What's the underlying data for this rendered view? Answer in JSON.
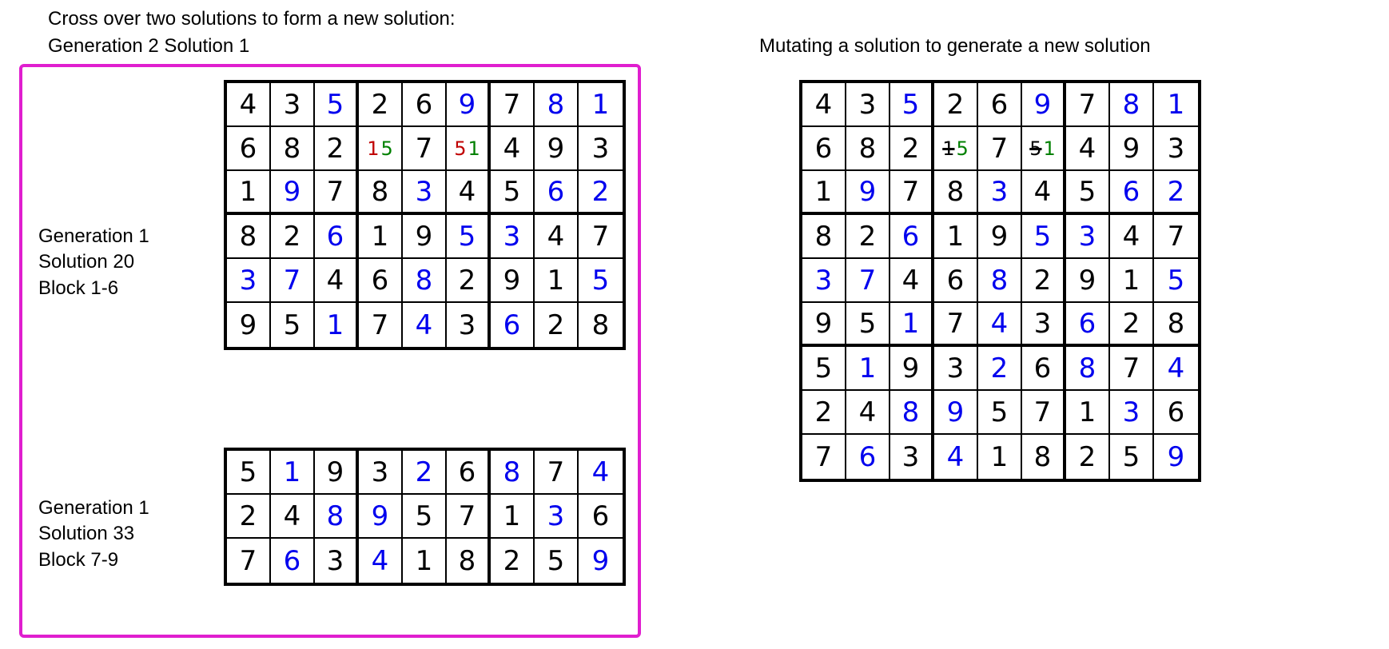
{
  "titles": {
    "crossover_line1": "Cross over two solutions to form a new solution:",
    "crossover_line2": "Generation 2 Solution 1",
    "mutation_title": "Mutating a solution to generate a new solution",
    "label_top": "Generation 1\nSolution 20\nBlock 1-6",
    "label_bottom": "Generation 1\nSolution 33\nBlock 7-9"
  },
  "colors": {
    "black": "#000000",
    "blue": "#0000ee",
    "red": "#c00000",
    "green": "#008000",
    "magenta": "#e01ecf"
  },
  "grid_top": {
    "rows": 6,
    "cells": [
      [
        {
          "v": "4",
          "c": "black"
        },
        {
          "v": "3",
          "c": "black"
        },
        {
          "v": "5",
          "c": "blue"
        },
        {
          "v": "2",
          "c": "black"
        },
        {
          "v": "6",
          "c": "black"
        },
        {
          "v": "9",
          "c": "blue"
        },
        {
          "v": "7",
          "c": "black"
        },
        {
          "v": "8",
          "c": "blue"
        },
        {
          "v": "1",
          "c": "blue"
        }
      ],
      [
        {
          "v": "6",
          "c": "black"
        },
        {
          "v": "8",
          "c": "black"
        },
        {
          "v": "2",
          "c": "black"
        },
        {
          "pair": [
            {
              "v": "1",
              "c": "red"
            },
            {
              "v": "5",
              "c": "green"
            }
          ]
        },
        {
          "v": "7",
          "c": "black"
        },
        {
          "pair": [
            {
              "v": "5",
              "c": "red"
            },
            {
              "v": "1",
              "c": "green"
            }
          ]
        },
        {
          "v": "4",
          "c": "black"
        },
        {
          "v": "9",
          "c": "black"
        },
        {
          "v": "3",
          "c": "black"
        }
      ],
      [
        {
          "v": "1",
          "c": "black"
        },
        {
          "v": "9",
          "c": "blue"
        },
        {
          "v": "7",
          "c": "black"
        },
        {
          "v": "8",
          "c": "black"
        },
        {
          "v": "3",
          "c": "blue"
        },
        {
          "v": "4",
          "c": "black"
        },
        {
          "v": "5",
          "c": "black"
        },
        {
          "v": "6",
          "c": "blue"
        },
        {
          "v": "2",
          "c": "blue"
        }
      ],
      [
        {
          "v": "8",
          "c": "black"
        },
        {
          "v": "2",
          "c": "black"
        },
        {
          "v": "6",
          "c": "blue"
        },
        {
          "v": "1",
          "c": "black"
        },
        {
          "v": "9",
          "c": "black"
        },
        {
          "v": "5",
          "c": "blue"
        },
        {
          "v": "3",
          "c": "blue"
        },
        {
          "v": "4",
          "c": "black"
        },
        {
          "v": "7",
          "c": "black"
        }
      ],
      [
        {
          "v": "3",
          "c": "blue"
        },
        {
          "v": "7",
          "c": "blue"
        },
        {
          "v": "4",
          "c": "black"
        },
        {
          "v": "6",
          "c": "black"
        },
        {
          "v": "8",
          "c": "blue"
        },
        {
          "v": "2",
          "c": "black"
        },
        {
          "v": "9",
          "c": "black"
        },
        {
          "v": "1",
          "c": "black"
        },
        {
          "v": "5",
          "c": "blue"
        }
      ],
      [
        {
          "v": "9",
          "c": "black"
        },
        {
          "v": "5",
          "c": "black"
        },
        {
          "v": "1",
          "c": "blue"
        },
        {
          "v": "7",
          "c": "black"
        },
        {
          "v": "4",
          "c": "blue"
        },
        {
          "v": "3",
          "c": "black"
        },
        {
          "v": "6",
          "c": "blue"
        },
        {
          "v": "2",
          "c": "black"
        },
        {
          "v": "8",
          "c": "black"
        }
      ]
    ]
  },
  "grid_bottom": {
    "rows": 3,
    "cells": [
      [
        {
          "v": "5",
          "c": "black"
        },
        {
          "v": "1",
          "c": "blue"
        },
        {
          "v": "9",
          "c": "black"
        },
        {
          "v": "3",
          "c": "black"
        },
        {
          "v": "2",
          "c": "blue"
        },
        {
          "v": "6",
          "c": "black"
        },
        {
          "v": "8",
          "c": "blue"
        },
        {
          "v": "7",
          "c": "black"
        },
        {
          "v": "4",
          "c": "blue"
        }
      ],
      [
        {
          "v": "2",
          "c": "black"
        },
        {
          "v": "4",
          "c": "black"
        },
        {
          "v": "8",
          "c": "blue"
        },
        {
          "v": "9",
          "c": "blue"
        },
        {
          "v": "5",
          "c": "black"
        },
        {
          "v": "7",
          "c": "black"
        },
        {
          "v": "1",
          "c": "black"
        },
        {
          "v": "3",
          "c": "blue"
        },
        {
          "v": "6",
          "c": "black"
        }
      ],
      [
        {
          "v": "7",
          "c": "black"
        },
        {
          "v": "6",
          "c": "blue"
        },
        {
          "v": "3",
          "c": "black"
        },
        {
          "v": "4",
          "c": "blue"
        },
        {
          "v": "1",
          "c": "black"
        },
        {
          "v": "8",
          "c": "black"
        },
        {
          "v": "2",
          "c": "black"
        },
        {
          "v": "5",
          "c": "black"
        },
        {
          "v": "9",
          "c": "blue"
        }
      ]
    ]
  },
  "grid_right": {
    "rows": 9,
    "cells": [
      [
        {
          "v": "4",
          "c": "black"
        },
        {
          "v": "3",
          "c": "black"
        },
        {
          "v": "5",
          "c": "blue"
        },
        {
          "v": "2",
          "c": "black"
        },
        {
          "v": "6",
          "c": "black"
        },
        {
          "v": "9",
          "c": "blue"
        },
        {
          "v": "7",
          "c": "black"
        },
        {
          "v": "8",
          "c": "blue"
        },
        {
          "v": "1",
          "c": "blue"
        }
      ],
      [
        {
          "v": "6",
          "c": "black"
        },
        {
          "v": "8",
          "c": "black"
        },
        {
          "v": "2",
          "c": "black"
        },
        {
          "pair": [
            {
              "v": "1",
              "c": "black",
              "strike": true
            },
            {
              "v": "5",
              "c": "green"
            }
          ]
        },
        {
          "v": "7",
          "c": "black"
        },
        {
          "pair": [
            {
              "v": "5",
              "c": "black",
              "strike": true
            },
            {
              "v": "1",
              "c": "green"
            }
          ]
        },
        {
          "v": "4",
          "c": "black"
        },
        {
          "v": "9",
          "c": "black"
        },
        {
          "v": "3",
          "c": "black"
        }
      ],
      [
        {
          "v": "1",
          "c": "black"
        },
        {
          "v": "9",
          "c": "blue"
        },
        {
          "v": "7",
          "c": "black"
        },
        {
          "v": "8",
          "c": "black"
        },
        {
          "v": "3",
          "c": "blue"
        },
        {
          "v": "4",
          "c": "black"
        },
        {
          "v": "5",
          "c": "black"
        },
        {
          "v": "6",
          "c": "blue"
        },
        {
          "v": "2",
          "c": "blue"
        }
      ],
      [
        {
          "v": "8",
          "c": "black"
        },
        {
          "v": "2",
          "c": "black"
        },
        {
          "v": "6",
          "c": "blue"
        },
        {
          "v": "1",
          "c": "black"
        },
        {
          "v": "9",
          "c": "black"
        },
        {
          "v": "5",
          "c": "blue"
        },
        {
          "v": "3",
          "c": "blue"
        },
        {
          "v": "4",
          "c": "black"
        },
        {
          "v": "7",
          "c": "black"
        }
      ],
      [
        {
          "v": "3",
          "c": "blue"
        },
        {
          "v": "7",
          "c": "blue"
        },
        {
          "v": "4",
          "c": "black"
        },
        {
          "v": "6",
          "c": "black"
        },
        {
          "v": "8",
          "c": "blue"
        },
        {
          "v": "2",
          "c": "black"
        },
        {
          "v": "9",
          "c": "black"
        },
        {
          "v": "1",
          "c": "black"
        },
        {
          "v": "5",
          "c": "blue"
        }
      ],
      [
        {
          "v": "9",
          "c": "black"
        },
        {
          "v": "5",
          "c": "black"
        },
        {
          "v": "1",
          "c": "blue"
        },
        {
          "v": "7",
          "c": "black"
        },
        {
          "v": "4",
          "c": "blue"
        },
        {
          "v": "3",
          "c": "black"
        },
        {
          "v": "6",
          "c": "blue"
        },
        {
          "v": "2",
          "c": "black"
        },
        {
          "v": "8",
          "c": "black"
        }
      ],
      [
        {
          "v": "5",
          "c": "black"
        },
        {
          "v": "1",
          "c": "blue"
        },
        {
          "v": "9",
          "c": "black"
        },
        {
          "v": "3",
          "c": "black"
        },
        {
          "v": "2",
          "c": "blue"
        },
        {
          "v": "6",
          "c": "black"
        },
        {
          "v": "8",
          "c": "blue"
        },
        {
          "v": "7",
          "c": "black"
        },
        {
          "v": "4",
          "c": "blue"
        }
      ],
      [
        {
          "v": "2",
          "c": "black"
        },
        {
          "v": "4",
          "c": "black"
        },
        {
          "v": "8",
          "c": "blue"
        },
        {
          "v": "9",
          "c": "blue"
        },
        {
          "v": "5",
          "c": "black"
        },
        {
          "v": "7",
          "c": "black"
        },
        {
          "v": "1",
          "c": "black"
        },
        {
          "v": "3",
          "c": "blue"
        },
        {
          "v": "6",
          "c": "black"
        }
      ],
      [
        {
          "v": "7",
          "c": "black"
        },
        {
          "v": "6",
          "c": "blue"
        },
        {
          "v": "3",
          "c": "black"
        },
        {
          "v": "4",
          "c": "blue"
        },
        {
          "v": "1",
          "c": "black"
        },
        {
          "v": "8",
          "c": "black"
        },
        {
          "v": "2",
          "c": "black"
        },
        {
          "v": "5",
          "c": "black"
        },
        {
          "v": "9",
          "c": "blue"
        }
      ]
    ]
  }
}
